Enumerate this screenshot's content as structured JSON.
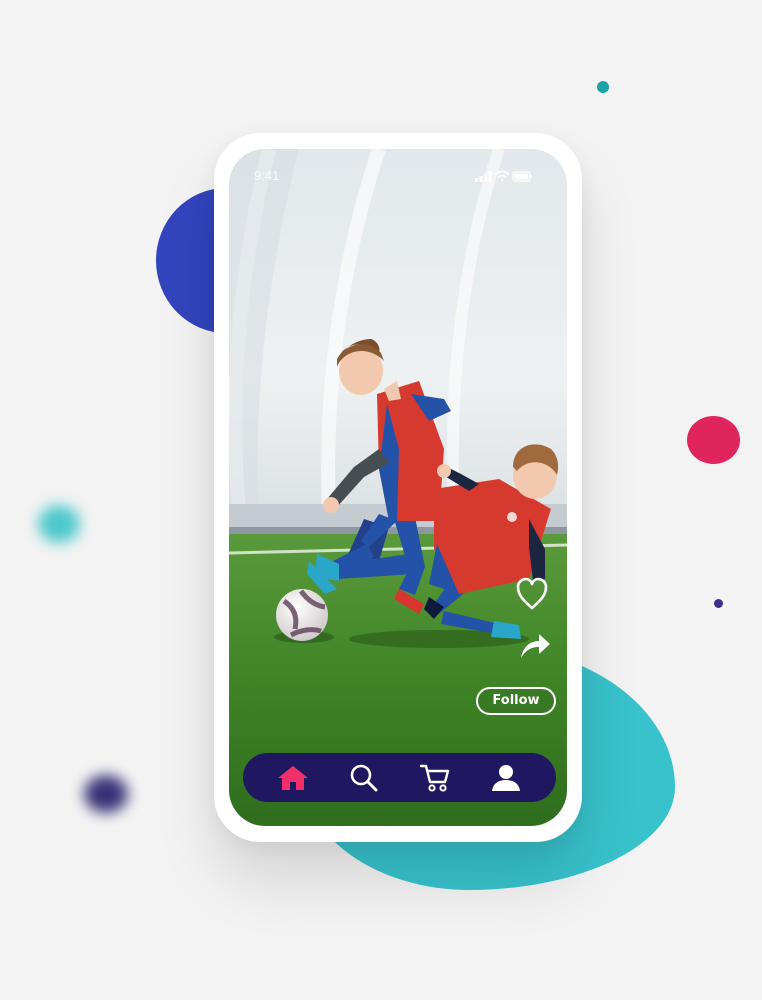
{
  "status_bar": {
    "time": "9:41",
    "icons": [
      "signal-icon",
      "wifi-icon",
      "battery-icon"
    ]
  },
  "post": {
    "actions": [
      "heart-icon",
      "share-icon"
    ],
    "follow_label": "Follow"
  },
  "bottom_nav": {
    "items": [
      {
        "name": "home",
        "icon": "home-icon",
        "active": true
      },
      {
        "name": "search",
        "icon": "search-icon",
        "active": false
      },
      {
        "name": "cart",
        "icon": "cart-icon",
        "active": false
      },
      {
        "name": "profile",
        "icon": "user-icon",
        "active": false
      }
    ]
  },
  "colors": {
    "nav_background": "#1f1860",
    "nav_active": "#f0306a",
    "nav_inactive": "#ffffff",
    "blob_teal": "#38c2cc",
    "blob_blue": "#3344bd",
    "accent_red": "#e0245e"
  }
}
